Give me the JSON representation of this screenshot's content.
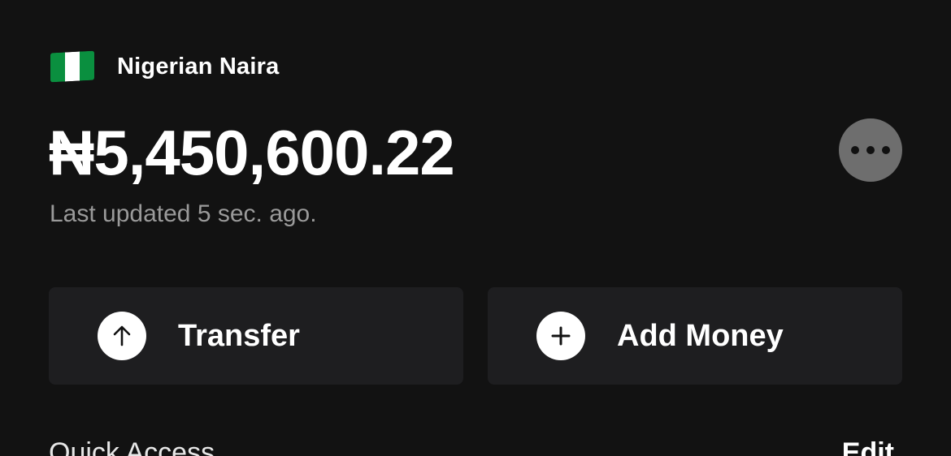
{
  "account": {
    "currency_name": "Nigerian Naira",
    "flag_icon": "nigeria-flag-icon",
    "flag_colors": [
      "#0a8f3f",
      "#ffffff",
      "#0a8f3f"
    ],
    "balance": "₦5,450,600.22",
    "last_updated": "Last updated 5 sec. ago."
  },
  "more_icon": "more-horizontal-icon",
  "actions": [
    {
      "label": "Transfer",
      "icon": "arrow-up-icon"
    },
    {
      "label": "Add Money",
      "icon": "plus-icon"
    }
  ],
  "quick_access": {
    "title": "Quick Access",
    "edit_label": "Edit"
  },
  "colors": {
    "background": "#121212",
    "card": "#1e1e20",
    "more_button": "#6e6e6e",
    "muted_text": "#9a9a9a"
  }
}
